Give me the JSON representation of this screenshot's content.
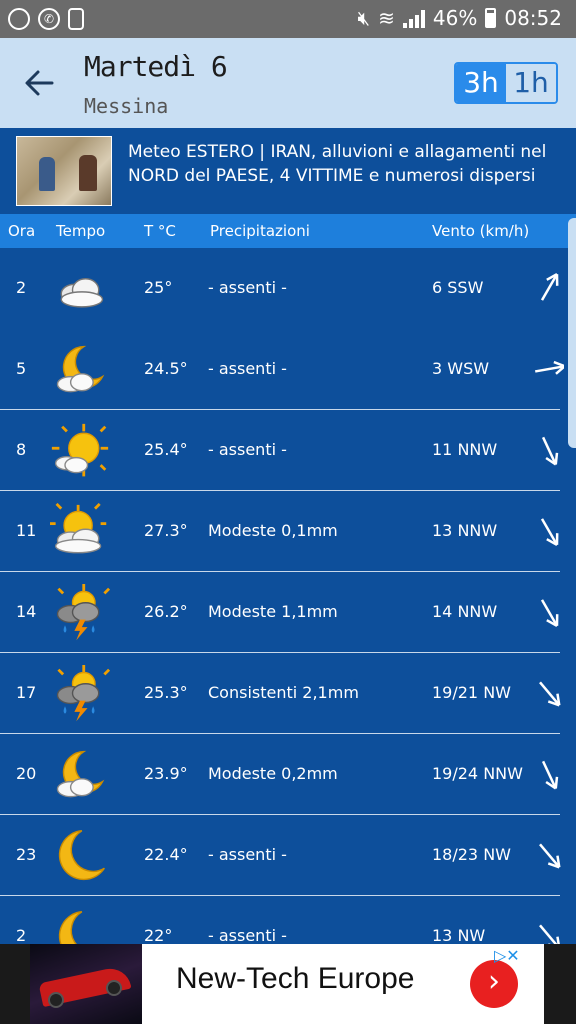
{
  "status_bar": {
    "battery": "46%",
    "time": "08:52"
  },
  "app_bar": {
    "title": "Martedì 6",
    "subtitle": "Messina",
    "toggle": {
      "active": "3h",
      "inactive": "1h"
    }
  },
  "news": {
    "text": "Meteo ESTERO | IRAN, alluvioni e allagamenti nel NORD del PAESE, 4 VITTIME e numerosi dispersi"
  },
  "table": {
    "headers": [
      "Ora",
      "Tempo",
      "T °C",
      "Precipitazioni",
      "Vento (km/h)"
    ],
    "rows": [
      {
        "ora": "2",
        "icon": "cloudy-icon",
        "temp": "25°",
        "prec": "- assenti -",
        "vento": "6 SSW",
        "arrow_deg": 30
      },
      {
        "ora": "5",
        "icon": "moon-cloud-icon",
        "temp": "24.5°",
        "prec": "- assenti -",
        "vento": "3 WSW",
        "arrow_deg": 80
      },
      {
        "ora": "8",
        "icon": "sun-cloud-icon",
        "temp": "25.4°",
        "prec": "- assenti -",
        "vento": "11 NNW",
        "arrow_deg": 155
      },
      {
        "ora": "11",
        "icon": "sun-behind-cloud-icon",
        "temp": "27.3°",
        "prec": "Modeste 0,1mm",
        "vento": "13 NNW",
        "arrow_deg": 150
      },
      {
        "ora": "14",
        "icon": "sun-thunderstorm-icon",
        "temp": "26.2°",
        "prec": "Modeste 1,1mm",
        "vento": "14 NNW",
        "arrow_deg": 150
      },
      {
        "ora": "17",
        "icon": "sun-thunderstorm-icon",
        "temp": "25.3°",
        "prec": "Consistenti 2,1mm",
        "vento": "19/21 NW",
        "arrow_deg": 140
      },
      {
        "ora": "20",
        "icon": "moon-cloud-icon",
        "temp": "23.9°",
        "prec": "Modeste 0,2mm",
        "vento": "19/24 NNW",
        "arrow_deg": 155
      },
      {
        "ora": "23",
        "icon": "moon-icon",
        "temp": "22.4°",
        "prec": "- assenti -",
        "vento": "18/23 NW",
        "arrow_deg": 140
      },
      {
        "ora": "2",
        "icon": "moon-icon",
        "temp": "22°",
        "prec": "- assenti -",
        "vento": "13 NW",
        "arrow_deg": 140
      }
    ]
  },
  "ad": {
    "title": "New-Tech Europe",
    "go": "›",
    "choices": "▷✕"
  }
}
